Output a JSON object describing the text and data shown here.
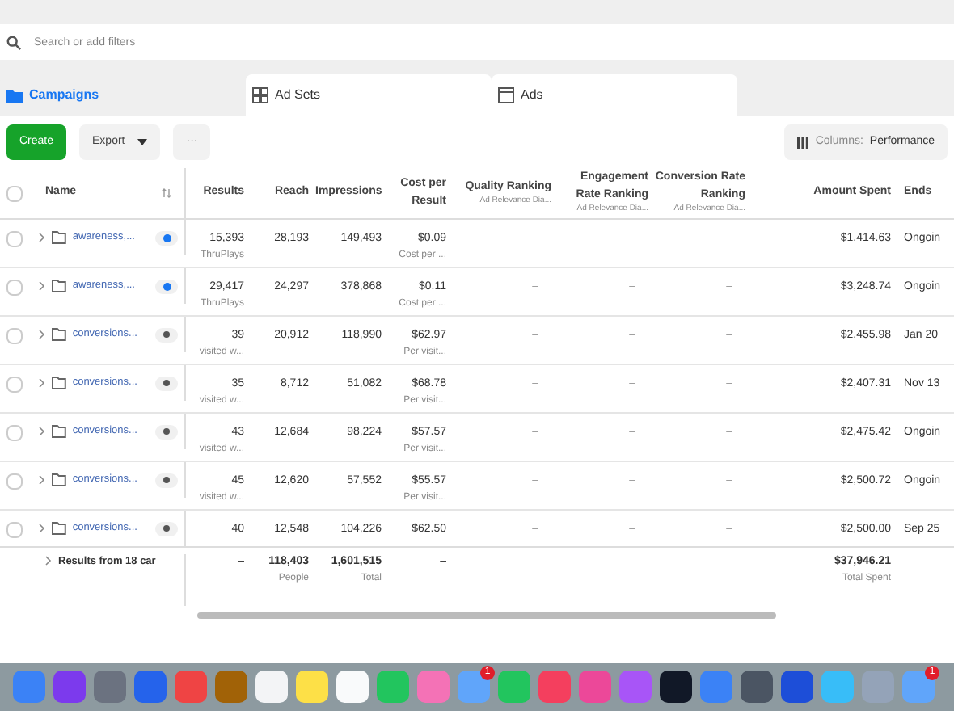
{
  "search": {
    "placeholder": "Search or add filters"
  },
  "tabs": [
    {
      "label": "Campaigns",
      "selected": true,
      "kind": "folder"
    },
    {
      "label": "Ad Sets",
      "selected": false,
      "kind": "grid"
    },
    {
      "label": "Ads",
      "selected": false,
      "kind": "page"
    }
  ],
  "toolbar": {
    "create": "Create",
    "export": "Export",
    "more": "···",
    "columns_label": "Columns:",
    "columns_value": "Performance"
  },
  "table": {
    "columns": [
      "Name",
      "Results",
      "Reach",
      "Impressions",
      "Cost per Result",
      "Quality Ranking",
      "Engagement Rate Ranking",
      "Conversion Rate Ranking",
      "Amount Spent",
      "Ends"
    ],
    "select_all_checked": false,
    "column_subs": {
      "quality": "Ad Relevance Dia...",
      "engagement": "Ad Relevance Dia...",
      "conversion": "Ad Relevance Dia..."
    },
    "rows": [
      {
        "name": "awareness,...",
        "checked": false,
        "on": true,
        "results": "15,393",
        "results_sub": "ThruPlays",
        "reach": "28,193",
        "impressions": "149,493",
        "cost": "$0.09",
        "cost_sub": "Cost per ...",
        "quality": "–",
        "engagement": "–",
        "conversion": "–",
        "amount": "$1,414.63",
        "ends": "Ongoin"
      },
      {
        "name": "awareness,...",
        "checked": false,
        "on": true,
        "results": "29,417",
        "results_sub": "ThruPlays",
        "reach": "24,297",
        "impressions": "378,868",
        "cost": "$0.11",
        "cost_sub": "Cost per ...",
        "quality": "–",
        "engagement": "–",
        "conversion": "–",
        "amount": "$3,248.74",
        "ends": "Ongoin"
      },
      {
        "name": "conversions...",
        "checked": false,
        "on": false,
        "results": "39",
        "results_sub": "visited w...",
        "reach": "20,912",
        "impressions": "118,990",
        "cost": "$62.97",
        "cost_sub": "Per visit...",
        "quality": "–",
        "engagement": "–",
        "conversion": "–",
        "amount": "$2,455.98",
        "ends": "Jan 20"
      },
      {
        "name": "conversions...",
        "checked": false,
        "on": false,
        "results": "35",
        "results_sub": "visited w...",
        "reach": "8,712",
        "impressions": "51,082",
        "cost": "$68.78",
        "cost_sub": "Per visit...",
        "quality": "–",
        "engagement": "–",
        "conversion": "–",
        "amount": "$2,407.31",
        "ends": "Nov 13"
      },
      {
        "name": "conversions...",
        "checked": false,
        "on": false,
        "results": "43",
        "results_sub": "visited w...",
        "reach": "12,684",
        "impressions": "98,224",
        "cost": "$57.57",
        "cost_sub": "Per visit...",
        "quality": "–",
        "engagement": "–",
        "conversion": "–",
        "amount": "$2,475.42",
        "ends": "Ongoin"
      },
      {
        "name": "conversions...",
        "checked": false,
        "on": false,
        "results": "45",
        "results_sub": "visited w...",
        "reach": "12,620",
        "impressions": "57,552",
        "cost": "$55.57",
        "cost_sub": "Per visit...",
        "quality": "–",
        "engagement": "–",
        "conversion": "–",
        "amount": "$2,500.72",
        "ends": "Ongoin"
      },
      {
        "name": "conversions...",
        "checked": false,
        "on": false,
        "results": "40",
        "reach": "12,548",
        "impressions": "104,226",
        "cost": "$62.50",
        "quality": "–",
        "engagement": "–",
        "conversion": "–",
        "amount": "$2,500.00",
        "ends": "Sep 25"
      }
    ],
    "totals": {
      "label": "Results from 18 car",
      "results": "–",
      "reach": "118,403",
      "reach_sub": "People",
      "impressions": "1,601,515",
      "impressions_sub": "Total",
      "cost": "–",
      "amount": "$37,946.21",
      "amount_sub": "Total Spent"
    }
  },
  "dock": [
    {
      "color": "#3b82f6"
    },
    {
      "color": "#7c3aed"
    },
    {
      "color": "#6b7280"
    },
    {
      "color": "#2563eb"
    },
    {
      "color": "#ef4444"
    },
    {
      "color": "#a16207"
    },
    {
      "color": "#f3f4f6"
    },
    {
      "color": "#fde047"
    },
    {
      "color": "#f9fafb"
    },
    {
      "color": "#22c55e"
    },
    {
      "color": "#f472b6"
    },
    {
      "color": "#60a5fa",
      "badge": "1"
    },
    {
      "color": "#22c55e"
    },
    {
      "color": "#f43f5e"
    },
    {
      "color": "#ec4899"
    },
    {
      "color": "#a855f7"
    },
    {
      "color": "#111827"
    },
    {
      "color": "#3b82f6"
    },
    {
      "color": "#4b5563"
    },
    {
      "color": "#1d4ed8"
    },
    {
      "color": "#38bdf8"
    },
    {
      "color": "#94a3b8"
    },
    {
      "color": "#60a5fa",
      "badge": "1"
    }
  ]
}
